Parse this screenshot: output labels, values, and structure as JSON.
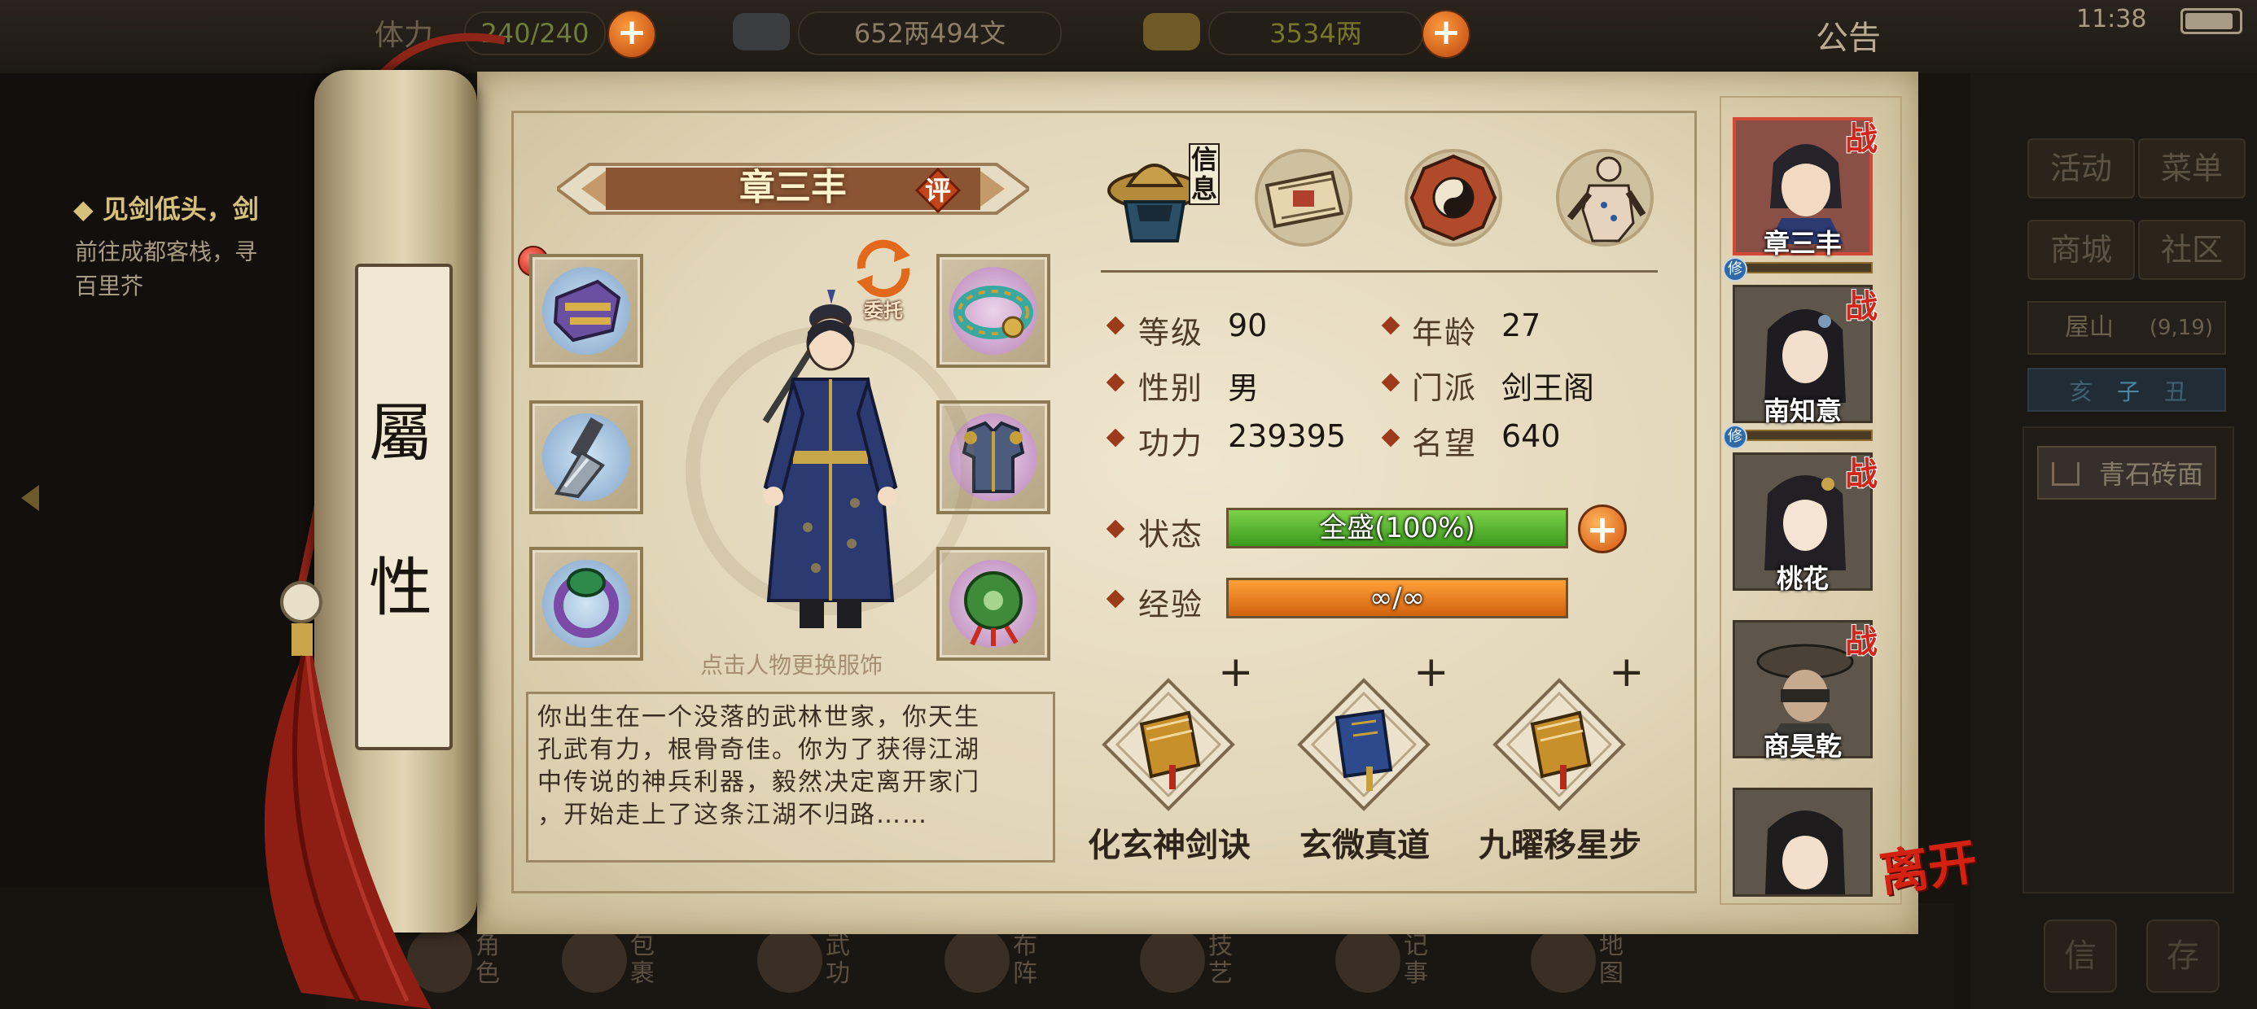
{
  "topbar": {
    "stamina_label": "体力",
    "stamina": "240/240",
    "copper": "652两494文",
    "silver": "3534两",
    "announcement": "公告",
    "time": "11:38"
  },
  "quest": {
    "title": "◆ 见剑低头，剑",
    "line1": "前往成都客栈，寻",
    "line2": "百里芥"
  },
  "scroll": {
    "title_top": "屬",
    "title_bottom": "性"
  },
  "character": {
    "name": "章三丰",
    "rate_label": "评",
    "entrust_label": "委托",
    "change_outfit_hint": "点击人物更换服饰",
    "bio_lines": [
      "你出生在一个没落的武林世家，你天生",
      "孔武有力，根骨奇佳。你为了获得江湖",
      "中传说的神兵利器，毅然决定离开家门",
      "，开始走上了这条江湖不归路……"
    ]
  },
  "equipment_slots": [
    {
      "name": "gloves",
      "icon": "gauntlet-icon",
      "color": "#6b4fa0"
    },
    {
      "name": "belt",
      "icon": "jade-belt-icon",
      "color": "#3aa7a0"
    },
    {
      "name": "weapon",
      "icon": "blade-icon",
      "color": "#6f7a86"
    },
    {
      "name": "armor",
      "icon": "armor-icon",
      "color": "#4c5c7c"
    },
    {
      "name": "ring",
      "icon": "jade-ring-icon",
      "color": "#2e8a4a"
    },
    {
      "name": "amulet",
      "icon": "jade-pendant-icon",
      "color": "#3e8c3a"
    }
  ],
  "tabs": [
    {
      "key": "info",
      "label": "信息",
      "icon": "straw-hat-hero-icon",
      "active": true
    },
    {
      "key": "map",
      "label": "",
      "icon": "scroll-map-icon",
      "active": false
    },
    {
      "key": "bagua",
      "label": "",
      "icon": "bagua-icon",
      "active": false
    },
    {
      "key": "meridians",
      "label": "",
      "icon": "body-meridian-icon",
      "active": false
    }
  ],
  "stats": {
    "level_label": "等级",
    "level": "90",
    "age_label": "年龄",
    "age": "27",
    "gender_label": "性别",
    "gender": "男",
    "sect_label": "门派",
    "sect": "剑王阁",
    "power_label": "功力",
    "power": "239395",
    "fame_label": "名望",
    "fame": "640",
    "status_label": "状态",
    "status_text": "全盛(100%)",
    "status_pct": 1.0,
    "exp_label": "经验",
    "exp_text": "∞/∞",
    "exp_pct": 1.0
  },
  "skills": [
    {
      "name": "化玄神剑诀",
      "book_color": "#c7902a",
      "plus": "+"
    },
    {
      "name": "玄微真道",
      "book_color": "#2d4a8c",
      "plus": "+"
    },
    {
      "name": "九曜移星步",
      "book_color": "#c7902a",
      "plus": "+"
    }
  ],
  "roster": [
    {
      "name": "章三丰",
      "zhan": "战",
      "xiu": "修",
      "active": true
    },
    {
      "name": "南知意",
      "zhan": "战",
      "xiu": "修",
      "active": false
    },
    {
      "name": "桃花",
      "zhan": "战",
      "xiu": "",
      "active": false
    },
    {
      "name": "商昊乾",
      "zhan": "战",
      "xiu": "",
      "active": false
    },
    {
      "name": "",
      "zhan": "",
      "xiu": "",
      "active": false
    }
  ],
  "leave_label": "离开",
  "side_menu": {
    "activity": "活动",
    "menu": "菜单",
    "shop": "商城",
    "community": "社区",
    "location": "屋山",
    "location_coord": "(9,19)",
    "time_chars": [
      "亥",
      "子",
      "丑"
    ],
    "tile": "青石砖面",
    "bottom_left": "信",
    "bottom_right": "存"
  },
  "bottom_nav": [
    {
      "label": "角色",
      "icon": "role-icon"
    },
    {
      "label": "包裹",
      "icon": "bag-icon"
    },
    {
      "label": "武功",
      "icon": "martial-icon"
    },
    {
      "label": "布阵",
      "icon": "formation-icon"
    },
    {
      "label": "技艺",
      "icon": "craft-icon"
    },
    {
      "label": "记事",
      "icon": "journal-icon"
    },
    {
      "label": "地图",
      "icon": "map-icon"
    }
  ]
}
